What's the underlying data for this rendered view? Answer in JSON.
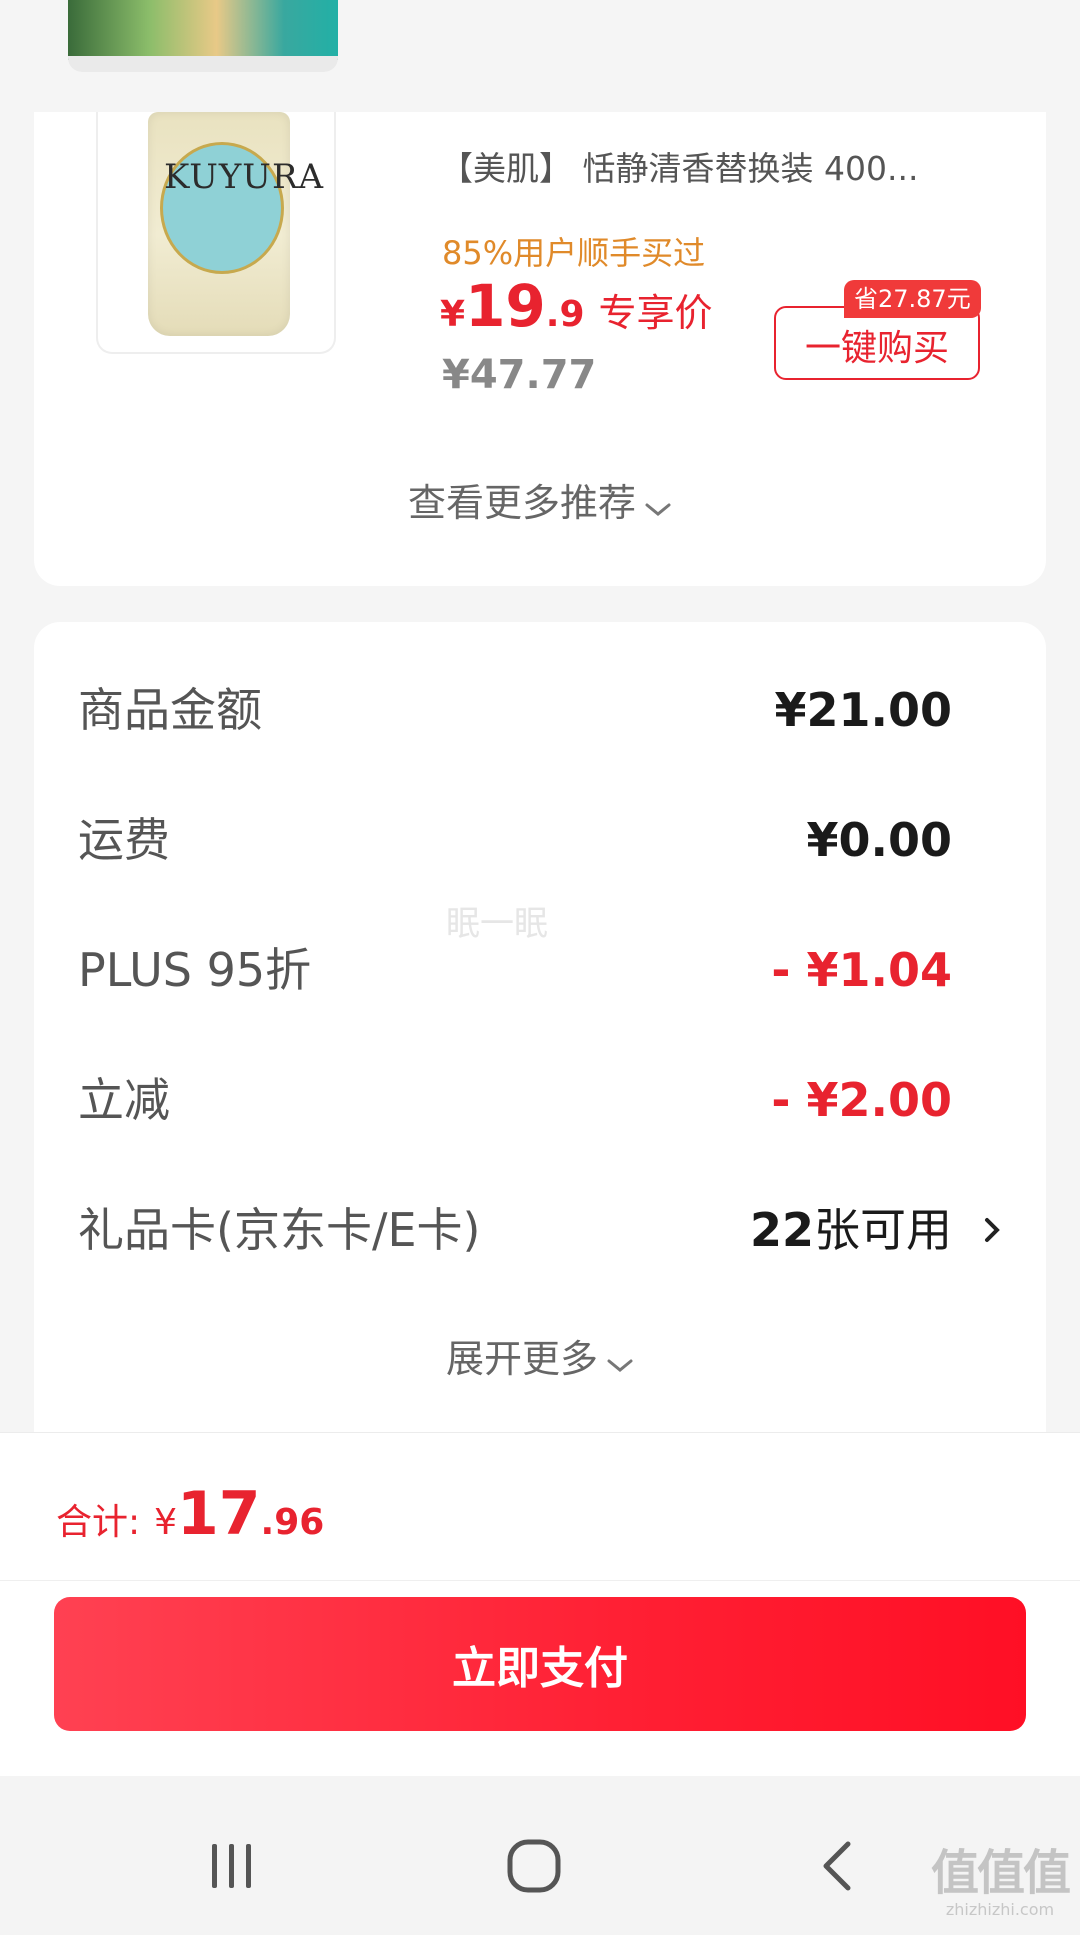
{
  "recommendation": {
    "product_title": "【美肌】 恬静清香替换装 400...",
    "product_image_brand": "KUYURA",
    "buyers_text": "85%用户顺手买过",
    "price_currency": "¥",
    "price_int": "19",
    "price_dec": ".9",
    "price_tag": "专享价",
    "original_price": "¥47.77",
    "save_badge": "省27.87元",
    "buy_button": "一键购买",
    "more_link": "查看更多推荐"
  },
  "details": {
    "rows": [
      {
        "label": "商品金额",
        "value": "¥21.00"
      },
      {
        "label": "运费",
        "value": "¥0.00"
      },
      {
        "label": "PLUS 95折",
        "value": "- ¥1.04"
      },
      {
        "label": "立减",
        "value": "- ¥2.00"
      },
      {
        "label": "礼品卡(京东卡/E卡)",
        "value_num": "22",
        "value_unit": "张可用"
      }
    ],
    "expand_link": "展开更多",
    "watermark": "眠一眠"
  },
  "footer": {
    "total_label": "合计:",
    "total_currency": "¥",
    "total_int": "17",
    "total_dec": ".96",
    "pay_button": "立即支付"
  },
  "watermark_site": {
    "mark": "值值值",
    "domain": "zhizhizhi.com"
  },
  "colors": {
    "accent_red": "#e8232f",
    "orange": "#e08a2a",
    "gray_text": "#555555"
  },
  "icons": [
    "chevron-down-icon",
    "chevron-right-icon",
    "recents-icon",
    "home-icon",
    "back-icon"
  ]
}
